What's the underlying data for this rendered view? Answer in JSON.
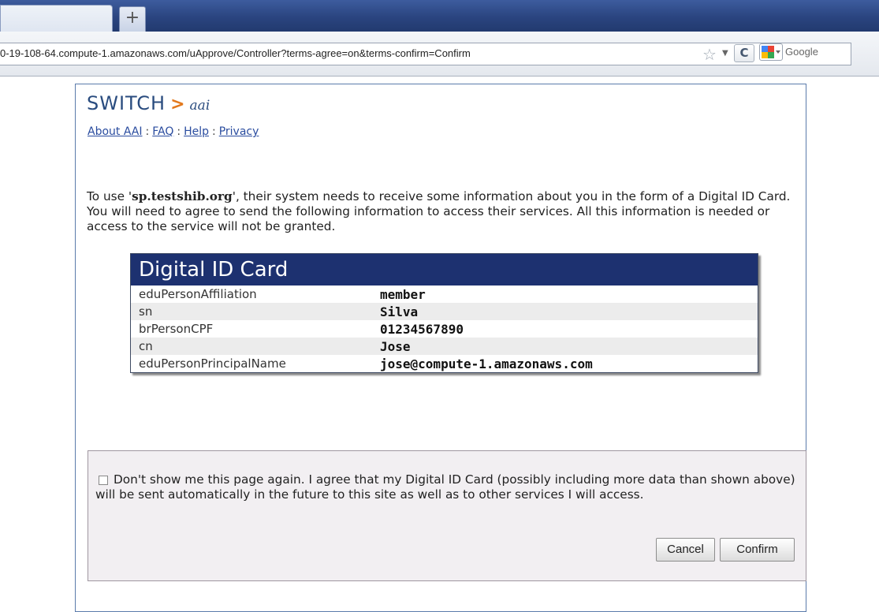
{
  "browser": {
    "new_tab_label": "+",
    "url": "0-19-108-64.compute-1.amazonaws.com/uApprove/Controller?terms-agree=on&terms-confirm=Confirm",
    "search_engine": "Google",
    "reload_label": "C"
  },
  "brand": {
    "name": "SWITCH",
    "arrow": ">",
    "suffix": "aai"
  },
  "nav": {
    "links": [
      "About AAI",
      "FAQ",
      "Help",
      "Privacy"
    ],
    "separator": ":"
  },
  "intro": {
    "before": "To use '",
    "sp": "sp.testshib.org",
    "after": "', their system needs to receive some information about you in the form of a Digital ID Card. You will need to agree to send the following information to access their services. All this information is needed or access to the service will not be granted."
  },
  "card": {
    "title": "Digital ID Card",
    "rows": [
      {
        "attribute": "eduPersonAffiliation",
        "value": "member"
      },
      {
        "attribute": "sn",
        "value": "Silva"
      },
      {
        "attribute": "brPersonCPF",
        "value": "01234567890"
      },
      {
        "attribute": "cn",
        "value": "Jose"
      },
      {
        "attribute": "eduPersonPrincipalName",
        "value": "jose@compute-1.amazonaws.com"
      }
    ]
  },
  "consent": {
    "checked": false,
    "text": "Don't show me this page again. I agree that my Digital ID Card (possibly including more data than shown above) will be sent automatically in the future to this site as well as to other services I will access.",
    "cancel_label": "Cancel",
    "confirm_label": "Confirm"
  },
  "colors": {
    "brand": "#2a4c7f",
    "accent": "#e2781c",
    "card_header": "#1d3170"
  }
}
